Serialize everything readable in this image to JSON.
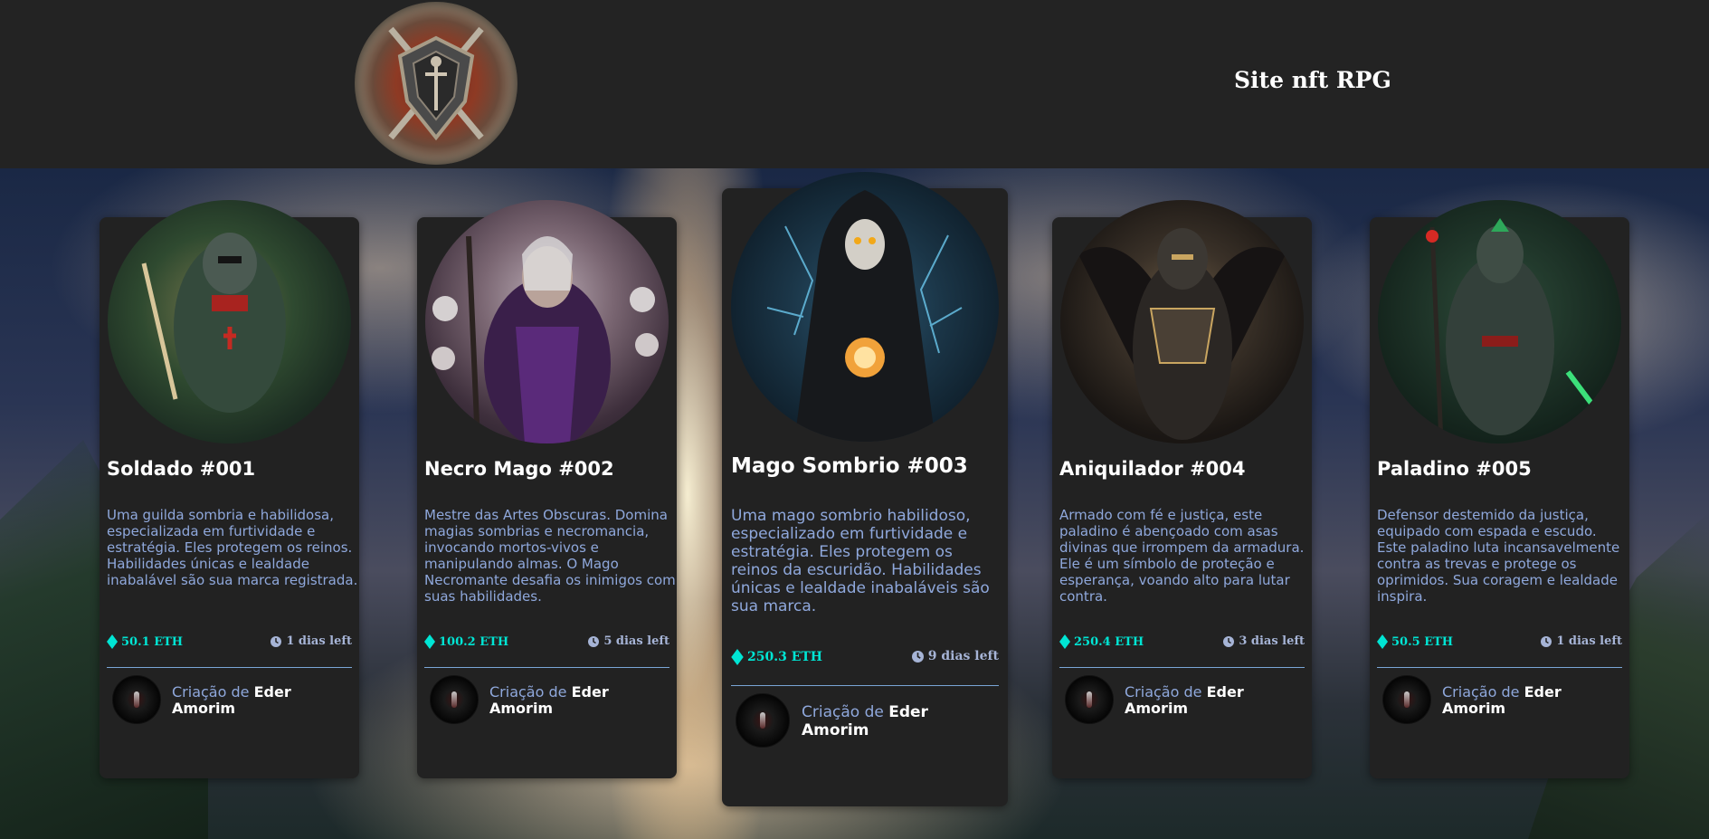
{
  "header": {
    "logo_icon": "shield-crest-icon",
    "title": "Site nft RPG"
  },
  "cards": [
    {
      "title": "Soldado #001",
      "description": "Uma guilda sombria e habilidosa, especializada em furtividade e estratégia. Eles protegem os reinos. Habilidades únicas e lealdade inabalável são sua marca registrada.",
      "price": "50.1 ETH",
      "time_left": "1 dias left",
      "credit_prefix": "Criação de",
      "credit_name": "Eder Amorim"
    },
    {
      "title": "Necro Mago #002",
      "description": "Mestre das Artes Obscuras. Domina magias sombrias e necromancia, invocando mortos-vivos e manipulando almas. O Mago Necromante desafia os inimigos com suas habilidades.",
      "price": "100.2 ETH",
      "time_left": "5 dias left",
      "credit_prefix": "Criação de",
      "credit_name": "Eder Amorim"
    },
    {
      "title": "Mago Sombrio #003",
      "description": "Uma mago sombrio habilidoso, especializado em furtividade e estratégia. Eles protegem os reinos da escuridão. Habilidades únicas e lealdade inabaláveis são sua marca.",
      "price": "250.3 ETH",
      "time_left": "9 dias left",
      "credit_prefix": "Criação de",
      "credit_name": "Eder Amorim"
    },
    {
      "title": "Aniquilador #004",
      "description": "Armado com fé e justiça, este paladino é abençoado com asas divinas que irrompem da armadura. Ele é um símbolo de proteção e esperança, voando alto para lutar contra.",
      "price": "250.4 ETH",
      "time_left": "3 dias left",
      "credit_prefix": "Criação de",
      "credit_name": "Eder Amorim"
    },
    {
      "title": "Paladino #005",
      "description": "Defensor destemido da justiça, equipado com espada e escudo. Este paladino luta incansavelmente contra as trevas e protege os oprimidos. Sua coragem e lealdade inspira.",
      "price": "50.5 ETH",
      "time_left": "1 dias left",
      "credit_prefix": "Criação de",
      "credit_name": "Eder Amorim"
    }
  ],
  "icons": {
    "price": "ethereum-icon",
    "time": "clock-icon"
  },
  "colors": {
    "header_bg": "#232323",
    "card_bg": "#222222",
    "price": "#00e5d4",
    "description": "#8fa8dc",
    "divider": "#7aa6d6"
  }
}
